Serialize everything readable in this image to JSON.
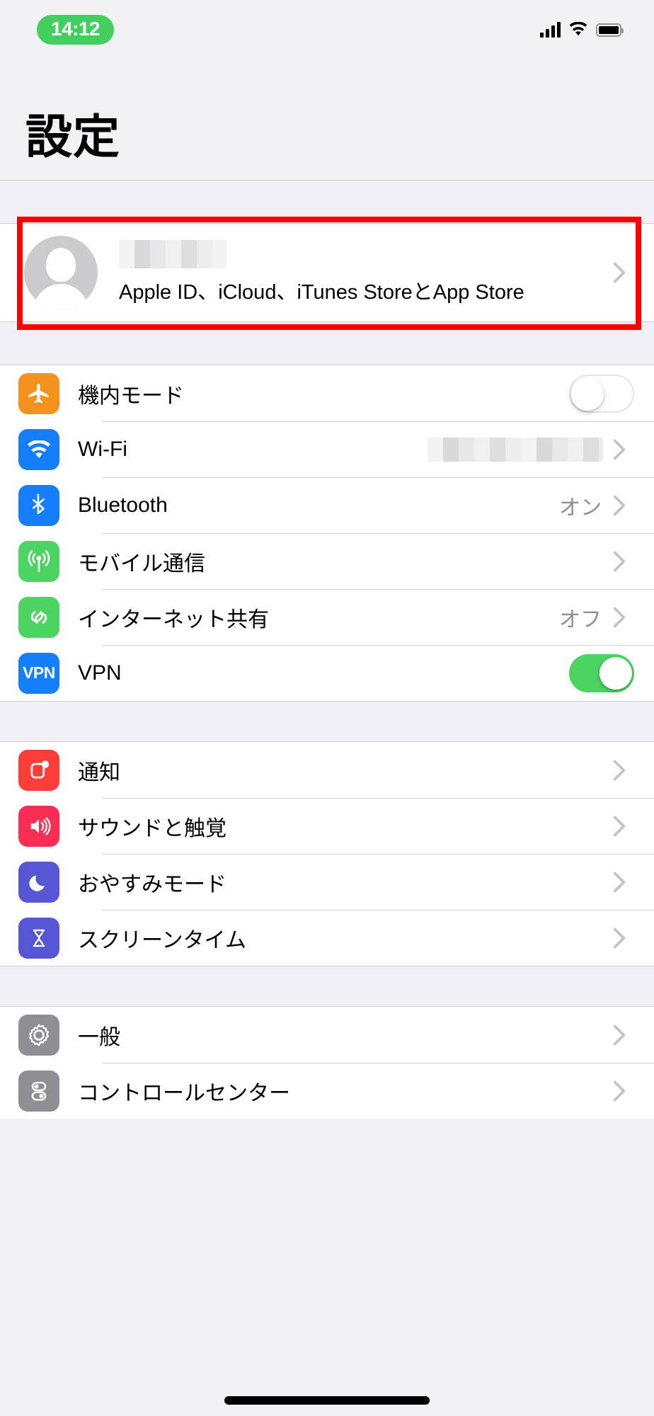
{
  "status_bar": {
    "time": "14:12",
    "time_pill_color": "#43CF5F",
    "signal_icon": "cellular-bars-icon",
    "wifi_icon": "wifi-icon",
    "battery_icon": "battery-full-icon"
  },
  "header": {
    "title": "設定"
  },
  "account": {
    "name_redacted": "",
    "subtitle": "Apple ID、iCloud、iTunes StoreとApp Store",
    "avatar_icon": "person-placeholder-icon",
    "chevron_icon": "chevron-right-icon",
    "highlight_color": "#FF0000"
  },
  "groups": [
    {
      "id": "connectivity",
      "rows": [
        {
          "label": "機内モード",
          "icon": "airplane-icon",
          "icon_color": "#F5921E",
          "control": "toggle",
          "toggle_on": false
        },
        {
          "label": "Wi-Fi",
          "icon": "wifi-icon",
          "icon_color": "#147EFB",
          "control": "chevron",
          "value_redacted": true
        },
        {
          "label": "Bluetooth",
          "icon": "bluetooth-icon",
          "icon_color": "#147EFB",
          "control": "chevron",
          "value": "オン"
        },
        {
          "label": "モバイル通信",
          "icon": "antenna-icon",
          "icon_color": "#4CD463",
          "control": "chevron",
          "value": ""
        },
        {
          "label": "インターネット共有",
          "icon": "hotspot-icon",
          "icon_color": "#4CD463",
          "control": "chevron",
          "value": "オフ"
        },
        {
          "label": "VPN",
          "icon": "vpn-icon",
          "icon_color": "#147EFB",
          "control": "toggle",
          "toggle_on": true
        }
      ]
    },
    {
      "id": "alerts",
      "rows": [
        {
          "label": "通知",
          "icon": "notifications-icon",
          "icon_color": "#FC3D39",
          "control": "chevron",
          "value": ""
        },
        {
          "label": "サウンドと触覚",
          "icon": "sound-icon",
          "icon_color": "#FC2D55",
          "control": "chevron",
          "value": ""
        },
        {
          "label": "おやすみモード",
          "icon": "moon-icon",
          "icon_color": "#5756D5",
          "control": "chevron",
          "value": ""
        },
        {
          "label": "スクリーンタイム",
          "icon": "hourglass-icon",
          "icon_color": "#5756D5",
          "control": "chevron",
          "value": ""
        }
      ]
    },
    {
      "id": "system",
      "rows": [
        {
          "label": "一般",
          "icon": "gear-icon",
          "icon_color": "#8E8E93",
          "control": "chevron",
          "value": ""
        },
        {
          "label": "コントロールセンター",
          "icon": "control-center-icon",
          "icon_color": "#8E8E93",
          "control": "chevron",
          "value": ""
        }
      ]
    }
  ]
}
